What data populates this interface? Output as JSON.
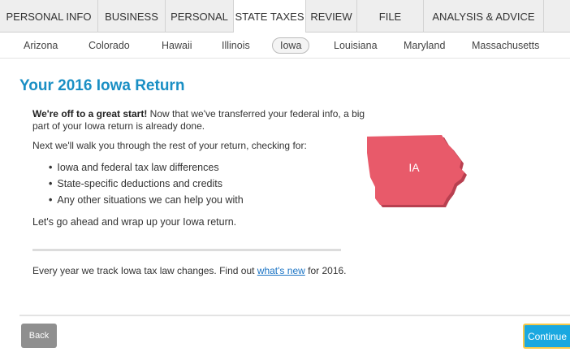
{
  "top_tabs": [
    {
      "label": "PERSONAL INFO"
    },
    {
      "label": "BUSINESS"
    },
    {
      "label": "PERSONAL"
    },
    {
      "label": "STATE TAXES"
    },
    {
      "label": "REVIEW"
    },
    {
      "label": "FILE"
    },
    {
      "label": "ANALYSIS & ADVICE"
    }
  ],
  "active_tab": "STATE TAXES",
  "states": [
    {
      "label": "Arizona"
    },
    {
      "label": "Colorado"
    },
    {
      "label": "Hawaii"
    },
    {
      "label": "Illinois"
    },
    {
      "label": "Iowa"
    },
    {
      "label": "Louisiana"
    },
    {
      "label": "Maryland"
    },
    {
      "label": "Massachusetts"
    }
  ],
  "active_state": "Iowa",
  "main": {
    "title": "Your 2016 Iowa Return",
    "intro_bold": "We're off to a great start!",
    "intro_rest": " Now that we've transferred your federal info, a big part of your Iowa return is already done.",
    "next_text": "Next we'll walk you through the rest of your return, checking for:",
    "bullets": [
      "Iowa and federal tax law differences",
      "State-specific deductions and credits",
      "Any other situations we can help you with"
    ],
    "wrapup": "Let's go ahead and wrap up your Iowa return.",
    "changes_prefix": "Every year we track Iowa tax law changes. Find out ",
    "changes_link": "what's new",
    "changes_suffix": " for 2016."
  },
  "map": {
    "label": "IA",
    "fill_color": "#e85a6a",
    "shadow_color": "#b84050"
  },
  "footer": {
    "back_label": "Back",
    "continue_label": "Continue"
  },
  "colors": {
    "title": "#1a8fc4",
    "link": "#1a73c4",
    "continue_bg": "#1aa8e0",
    "continue_border": "#f7c948",
    "back_bg": "#8f8f8f"
  }
}
